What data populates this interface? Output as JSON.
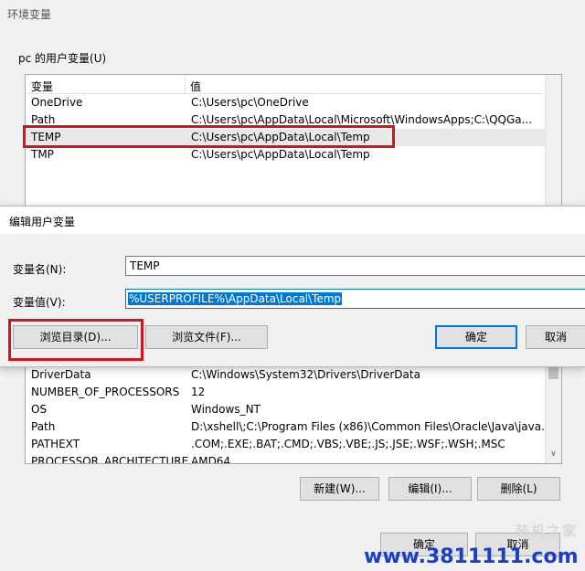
{
  "window": {
    "title": "环境变量"
  },
  "user_vars": {
    "group_label": "pc 的用户变量(U)",
    "col_name": "变量",
    "col_value": "值",
    "rows": [
      {
        "name": "OneDrive",
        "value": "C:\\Users\\pc\\OneDrive"
      },
      {
        "name": "Path",
        "value": "C:\\Users\\pc\\AppData\\Local\\Microsoft\\WindowsApps;C:\\QQGa..."
      },
      {
        "name": "TEMP",
        "value": "C:\\Users\\pc\\AppData\\Local\\Temp"
      },
      {
        "name": "TMP",
        "value": "C:\\Users\\pc\\AppData\\Local\\Temp"
      }
    ]
  },
  "edit_dialog": {
    "title": "编辑用户变量",
    "name_label": "变量名(N):",
    "name_value": "TEMP",
    "value_label": "变量值(V):",
    "value_value": "%USERPROFILE%\\AppData\\Local\\Temp",
    "browse_dir": "浏览目录(D)...",
    "browse_file": "浏览文件(F)...",
    "ok": "确定",
    "cancel": "取消"
  },
  "system_vars": {
    "rows": [
      {
        "name": "DriverData",
        "value": "C:\\Windows\\System32\\Drivers\\DriverData"
      },
      {
        "name": "NUMBER_OF_PROCESSORS",
        "value": "12"
      },
      {
        "name": "OS",
        "value": "Windows_NT"
      },
      {
        "name": "Path",
        "value": "D:\\xshell\\;C:\\Program Files (x86)\\Common Files\\Oracle\\Java\\java..."
      },
      {
        "name": "PATHEXT",
        "value": ".COM;.EXE;.BAT;.CMD;.VBS;.VBE;.JS;.JSE;.WSF;.WSH;.MSC"
      },
      {
        "name": "PROCESSOR_ARCHITECTURE",
        "value": "AMD64"
      }
    ],
    "btn_new": "新建(W)...",
    "btn_edit": "编辑(I)...",
    "btn_delete": "删除(L)"
  },
  "footer": {
    "ok": "确定",
    "cancel": "取消"
  },
  "watermark": {
    "logo": "装机之家",
    "url": "www.3811111.com"
  },
  "colors": {
    "highlight": "#0078d7",
    "annotation": "#d0161c",
    "watermark_url": "#1a3ec8"
  }
}
